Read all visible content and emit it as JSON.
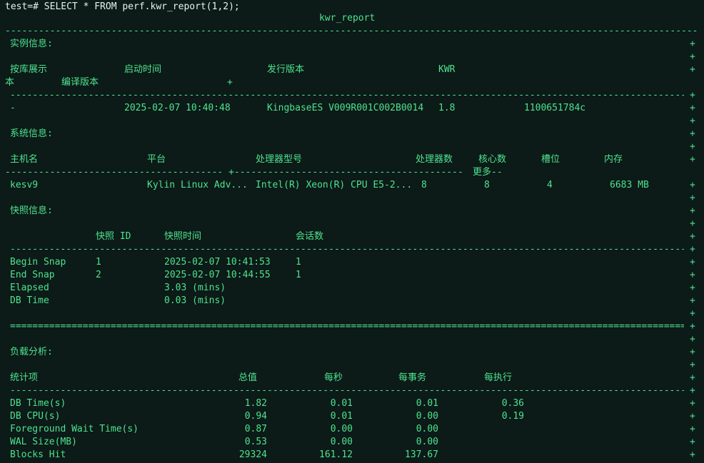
{
  "prompt": "test=# SELECT * FROM perf.kwr_report(1,2);",
  "column_header": "kwr_report",
  "dash_full": "---------------------------------------------------------------------------------------------------------------------------------------------",
  "dash_inner": "--------------------------------------------------------------------------------------------------------------------------------------",
  "equals_inner": "=======================================================================================================================================",
  "instance": {
    "title": "实例信息:",
    "h_show": "按库展示",
    "h_start": "启动时间",
    "h_release": "发行版本",
    "h_kwr": "KWR",
    "wrap_ben": "本",
    "h_compile": "编译版本",
    "row_show": "-",
    "row_start": "2025-02-07 10:40:48",
    "row_release": "KingbaseES V009R001C002B0014",
    "row_kwr": "1.8",
    "row_compile": "1100651784c"
  },
  "system": {
    "title": "系统信息:",
    "h_host": "主机名",
    "h_platform": "平台",
    "h_cpu_model": "处理器型号",
    "h_cpus": "处理器数",
    "h_cores": "核心数",
    "h_sockets": "槽位",
    "h_mem": "内存",
    "sep_left": "--------------------------------------- +-----------------------------------------",
    "more": "更多",
    "row_host": "kesv9",
    "row_platform": "Kylin Linux Adv...",
    "row_cpu_model": "Intel(R) Xeon(R) CPU E5-2...",
    "row_cpus": "8",
    "row_cores": "8",
    "row_sockets": "4",
    "row_mem": "6683 MB"
  },
  "snapshot": {
    "title": "快照信息:",
    "h_snap": "快照 ID",
    "h_time": "快照时间",
    "h_sessions": "会话数",
    "rows": [
      {
        "label": "Begin Snap",
        "id": "1",
        "time": "2025-02-07 10:41:53",
        "sessions": "1"
      },
      {
        "label": "End Snap",
        "id": "2",
        "time": "2025-02-07 10:44:55",
        "sessions": "1"
      },
      {
        "label": "Elapsed",
        "id": "",
        "time": "3.03 (mins)",
        "sessions": ""
      },
      {
        "label": "DB Time",
        "id": "",
        "time": "0.03 (mins)",
        "sessions": ""
      }
    ]
  },
  "load": {
    "title": "负载分析:",
    "h_item": "统计项",
    "h_total": "总值",
    "h_per_sec": "每秒",
    "h_per_txn": "每事务",
    "h_per_exec": "每执行",
    "rows": [
      {
        "item": "DB Time(s)",
        "total": "1.82",
        "per_sec": "0.01",
        "per_txn": "0.01",
        "per_exec": "0.36"
      },
      {
        "item": "DB CPU(s)",
        "total": "0.94",
        "per_sec": "0.01",
        "per_txn": "0.00",
        "per_exec": "0.19"
      },
      {
        "item": "Foreground Wait Time(s)",
        "total": "0.87",
        "per_sec": "0.00",
        "per_txn": "0.00",
        "per_exec": ""
      },
      {
        "item": "WAL Size(MB)",
        "total": "0.53",
        "per_sec": "0.00",
        "per_txn": "0.00",
        "per_exec": ""
      },
      {
        "item": "Blocks Hit",
        "total": "29324",
        "per_sec": "161.12",
        "per_txn": "137.67",
        "per_exec": ""
      }
    ]
  },
  "plus": "+"
}
